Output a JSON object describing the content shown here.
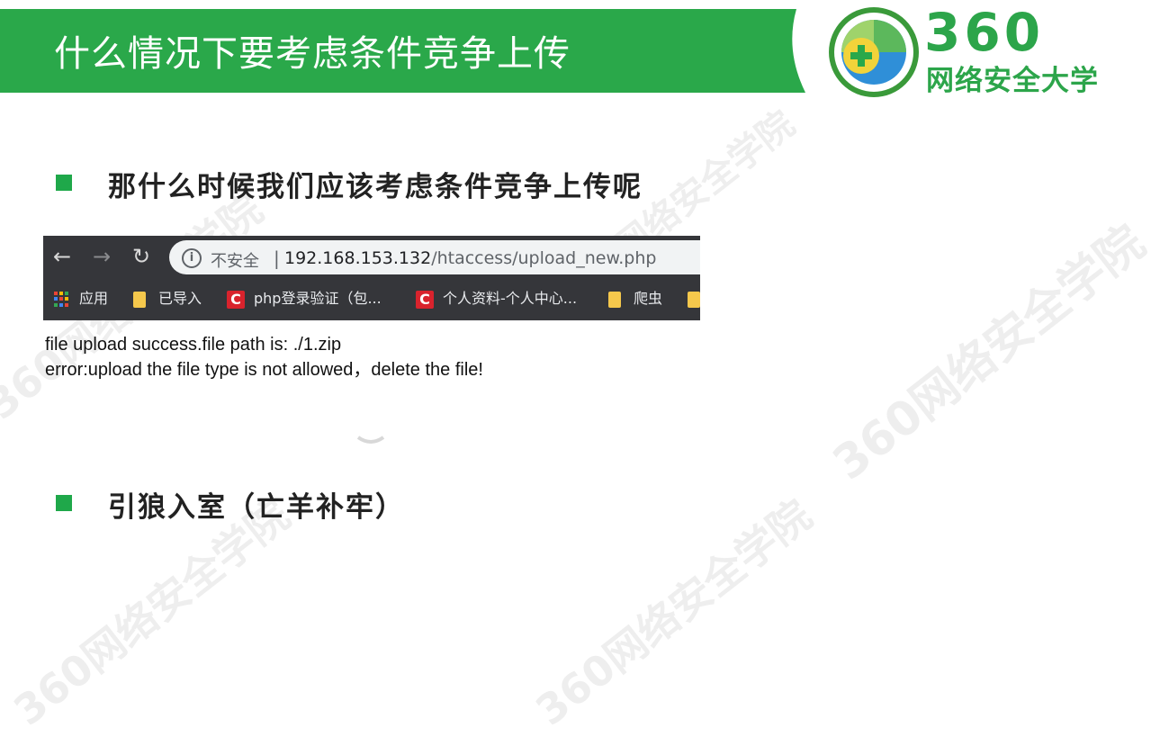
{
  "slide": {
    "title": "什么情况下要考虑条件竞争上传",
    "bullets": [
      "那什么时候我们应该考虑条件竞争上传呢",
      "引狼入室（亡羊补牢）"
    ]
  },
  "logo": {
    "number": "360",
    "text": "网络安全大学"
  },
  "watermark": {
    "text": "360网络安全学院"
  },
  "browser": {
    "security_label": "不安全",
    "separator": "|",
    "url_host": "192.168.153.132",
    "url_path": "/htaccess/upload_new.php",
    "bookmarks": [
      {
        "label": "应用",
        "icon": "apps-icon"
      },
      {
        "label": "已导入",
        "icon": "folder-icon"
      },
      {
        "label": "php登录验证（包...",
        "icon": "c-logo-icon"
      },
      {
        "label": "个人资料-个人中心...",
        "icon": "c-logo-icon"
      },
      {
        "label": "爬虫",
        "icon": "folder-icon"
      }
    ]
  },
  "page_output": {
    "line1": "file upload success.file path is: ./1.zip",
    "line2": "error:upload the file type is not allowed，delete the file!"
  },
  "colors": {
    "banner_green": "#2aa84a",
    "bullet_green": "#1fa84a",
    "logo_green": "#2ca54a",
    "browser_dark": "#35363a"
  }
}
